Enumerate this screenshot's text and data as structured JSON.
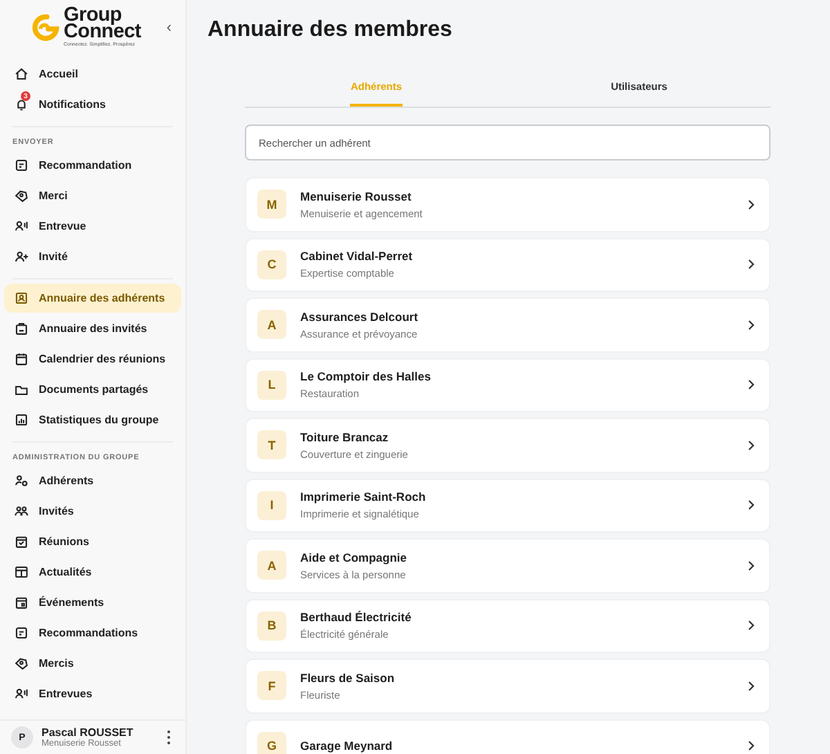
{
  "brand": {
    "name_top": "Group",
    "name_bottom": "Connect",
    "tagline": "Connectez. Simplifiez. Prospérez"
  },
  "sidebar": {
    "collapse": "‹",
    "groups": [
      {
        "items": [
          {
            "label": "Accueil",
            "selected": false
          },
          {
            "label": "Notifications",
            "selected": false,
            "badge": "3"
          }
        ]
      },
      {
        "heading": "ENVOYER",
        "items": [
          {
            "label": "Recommandation",
            "selected": false
          },
          {
            "label": "Merci",
            "selected": false
          },
          {
            "label": "Entrevue",
            "selected": false
          },
          {
            "label": "Invité",
            "selected": false
          }
        ]
      },
      {
        "items": [
          {
            "label": "Annuaire des adhérents",
            "selected": true
          },
          {
            "label": "Annuaire des invités",
            "selected": false
          },
          {
            "label": "Calendrier des réunions",
            "selected": false
          },
          {
            "label": "Documents partagés",
            "selected": false
          },
          {
            "label": "Statistiques du groupe",
            "selected": false
          }
        ]
      },
      {
        "heading": "ADMINISTRATION DU GROUPE",
        "items": [
          {
            "label": "Adhérents",
            "selected": false
          },
          {
            "label": "Invités",
            "selected": false
          },
          {
            "label": "Réunions",
            "selected": false
          },
          {
            "label": "Actualités",
            "selected": false
          },
          {
            "label": "Événements",
            "selected": false
          },
          {
            "label": "Recommandations",
            "selected": false
          },
          {
            "label": "Mercis",
            "selected": false
          },
          {
            "label": "Entrevues",
            "selected": false
          }
        ]
      }
    ],
    "user": {
      "initial": "P",
      "name": "Pascal ROUSSET",
      "company": "Menuiserie Rousset"
    }
  },
  "page": {
    "title": "Annuaire des membres",
    "tabs": [
      {
        "label": "Adhérents",
        "selected": true
      },
      {
        "label": "Utilisateurs",
        "selected": false
      }
    ],
    "search": {
      "placeholder": "Rechercher un adhérent"
    },
    "members": [
      {
        "initial": "M",
        "name": "Menuiserie Rousset",
        "activity": "Menuiserie et agencement"
      },
      {
        "initial": "C",
        "name": "Cabinet Vidal-Perret",
        "activity": "Expertise comptable"
      },
      {
        "initial": "A",
        "name": "Assurances Delcourt",
        "activity": "Assurance et prévoyance"
      },
      {
        "initial": "L",
        "name": "Le Comptoir des Halles",
        "activity": "Restauration"
      },
      {
        "initial": "T",
        "name": "Toiture Brancaz",
        "activity": "Couverture et zinguerie"
      },
      {
        "initial": "I",
        "name": "Imprimerie Saint-Roch",
        "activity": "Imprimerie et signalétique"
      },
      {
        "initial": "A",
        "name": "Aide et Compagnie",
        "activity": "Services à la personne"
      },
      {
        "initial": "B",
        "name": "Berthaud Électricité",
        "activity": "Électricité générale"
      },
      {
        "initial": "F",
        "name": "Fleurs de Saison",
        "activity": "Fleuriste"
      },
      {
        "initial": "G",
        "name": "Garage Meynard"
      }
    ]
  }
}
